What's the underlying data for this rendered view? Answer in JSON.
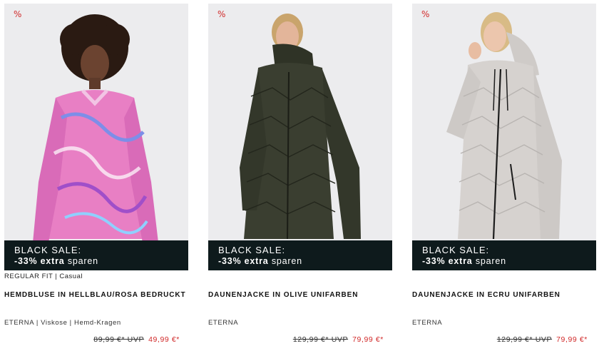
{
  "colors": {
    "sale_bar": "#0e1a1c",
    "sale_price": "#d12a2a",
    "card_bg": "#ececee"
  },
  "products": [
    {
      "badge": "%",
      "image_alt": "model wearing a pink and blue patterned blouse",
      "sale_line1": "BLACK SALE:",
      "sale_line2_bold": "-33% extra",
      "sale_line2_rest": " sparen",
      "fit": "REGULAR FIT | Casual",
      "name": "HEMDBLUSE IN HELLBLAU/ROSA BEDRUCKT",
      "attributes": "ETERNA | Viskose | Hemd-Kragen",
      "old_price": "89,99 €* UVP",
      "new_price": "49,99 €*"
    },
    {
      "badge": "%",
      "image_alt": "model wearing a long olive quilted down jacket",
      "sale_line1": "BLACK SALE:",
      "sale_line2_bold": "-33% extra",
      "sale_line2_rest": " sparen",
      "fit": "",
      "name": "DAUNENJACKE IN OLIVE UNIFARBEN",
      "attributes": "ETERNA",
      "old_price": "129,99 €* UVP",
      "new_price": "79,99 €*"
    },
    {
      "badge": "%",
      "image_alt": "model wearing a long ecru quilted down jacket",
      "sale_line1": "BLACK SALE:",
      "sale_line2_bold": "-33% extra",
      "sale_line2_rest": " sparen",
      "fit": "",
      "name": "DAUNENJACKE IN ECRU UNIFARBEN",
      "attributes": "ETERNA",
      "old_price": "129,99 €* UVP",
      "new_price": "79,99 €*"
    }
  ]
}
